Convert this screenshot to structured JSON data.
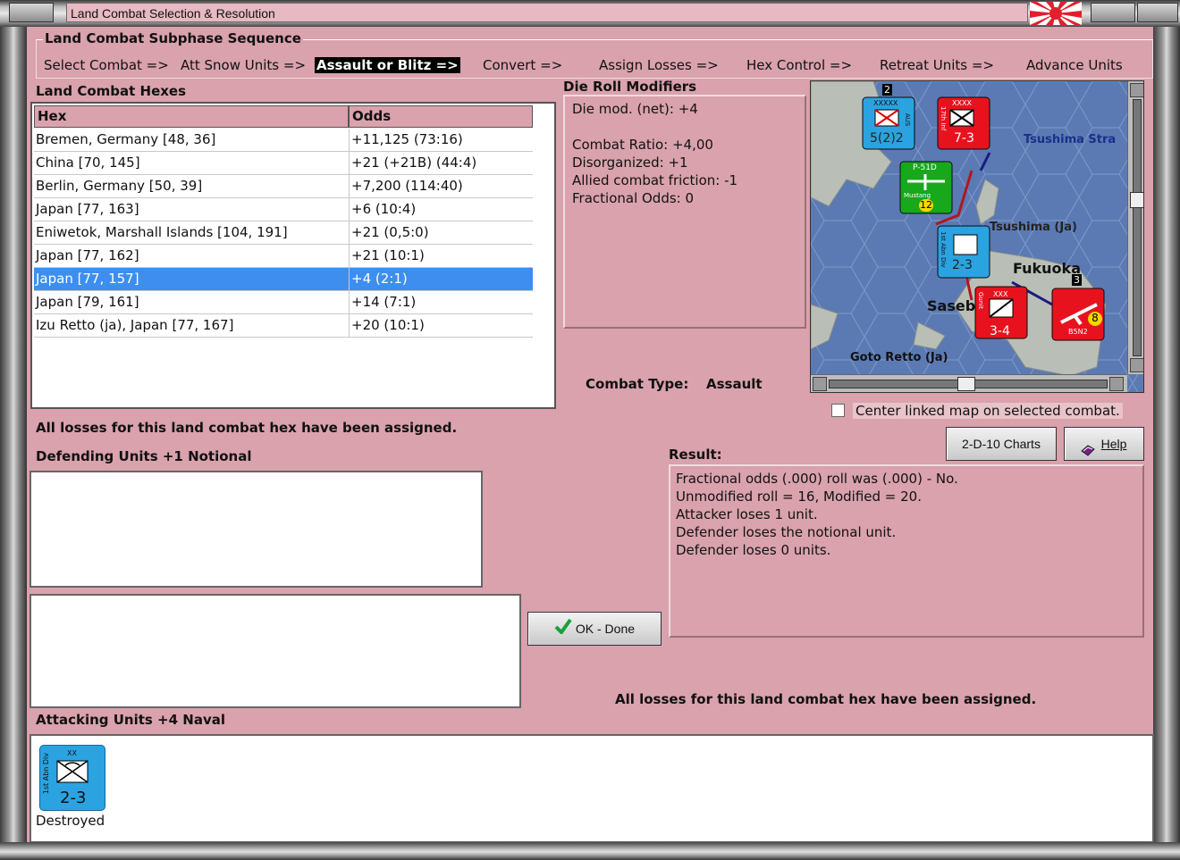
{
  "window": {
    "title": "Land Combat Selection & Resolution"
  },
  "sequence": {
    "title": "Land Combat Subphase Sequence",
    "steps": [
      {
        "label": "Select Combat =>"
      },
      {
        "label": "Att Snow Units =>"
      },
      {
        "label": "Assault or Blitz =>"
      },
      {
        "label": "Convert =>"
      },
      {
        "label": "Assign Losses =>"
      },
      {
        "label": "Hex Control =>"
      },
      {
        "label": "Retreat Units =>"
      },
      {
        "label": "Advance Units"
      }
    ],
    "active_step": "Assault or Blitz =>"
  },
  "hexes": {
    "title": "Land Combat Hexes",
    "columns": [
      "Hex",
      "Odds"
    ],
    "rows": [
      {
        "hex": "Bremen, Germany [48, 36]",
        "odds": "+11,125 (73:16)"
      },
      {
        "hex": "China [70, 145]",
        "odds": "+21 (+21B) (44:4)"
      },
      {
        "hex": "Berlin, Germany [50, 39]",
        "odds": "+7,200 (114:40)"
      },
      {
        "hex": "Japan [77, 163]",
        "odds": "+6 (10:4)"
      },
      {
        "hex": "Eniwetok, Marshall Islands [104, 191]",
        "odds": "+21 (0,5:0)"
      },
      {
        "hex": "Japan [77, 162]",
        "odds": "+21 (10:1)"
      },
      {
        "hex": "Japan [77, 157]",
        "odds": "+4 (2:1)"
      },
      {
        "hex": "Japan [79, 161]",
        "odds": "+14 (7:1)"
      },
      {
        "hex": "Izu Retto (ja), Japan [77, 167]",
        "odds": "+20 (10:1)"
      }
    ],
    "selected_index": 6
  },
  "modifiers": {
    "title": "Die Roll Modifiers",
    "lines": [
      "Die mod. (net): +4",
      "",
      "Combat Ratio: +4,00",
      "Disorganized: +1",
      "Allied combat friction: -1",
      "Fractional Odds: 0"
    ]
  },
  "combat_type": {
    "label": "Combat Type:",
    "value": "Assault"
  },
  "map": {
    "labels": {
      "tsushima_strait": "Tsushima Stra",
      "tsushima": "Tsushima (Ja)",
      "fukuoka": "Fukuoka",
      "sasebo": "Saseb",
      "goto_retto": "Goto Retto (Ja)"
    },
    "units": [
      {
        "top": "XXXXX",
        "value": "5(2)2",
        "side": "AUS",
        "color": "#2aa3e0"
      },
      {
        "top": "XXXX",
        "value": "7-3",
        "side": "17th Inf",
        "color": "#e8121e"
      },
      {
        "top": "P-51D",
        "value": "12",
        "side": "Mustang",
        "color": "#17a81c"
      },
      {
        "top": "",
        "value": "2-3",
        "side": "1st Abn Div",
        "color": "#2aa3e0"
      },
      {
        "top": "XXX",
        "value": "3-4",
        "side": "Gunit",
        "color": "#e8121e"
      },
      {
        "top": "",
        "value": "8",
        "side": "B5N2",
        "color": "#e8121e"
      }
    ],
    "hex_numbers": [
      "2",
      "3"
    ]
  },
  "center_linked": {
    "label": "Center linked map on selected combat.",
    "checked": false
  },
  "buttons": {
    "charts": "2-D-10 Charts",
    "help": "Help",
    "ok": "OK - Done"
  },
  "status_message": "All losses for this land combat hex have been assigned.",
  "status_message_lower": "All losses for this land combat hex have been assigned.",
  "defending": {
    "title": "Defending Units +1 Notional"
  },
  "result": {
    "title": "Result:",
    "lines": [
      "Fractional odds (.000) roll was (.000)  - No.",
      "Unmodified roll = 16, Modified = 20.",
      "Attacker loses 1 unit.",
      "Defender loses the notional unit.",
      "Defender loses 0 units."
    ]
  },
  "attacking": {
    "title": "Attacking Units +4 Naval",
    "units": [
      {
        "size": "XX",
        "name": "1st Abn Div",
        "value": "2-3",
        "status": "Destroyed",
        "color": "#2aa3e0"
      }
    ]
  }
}
